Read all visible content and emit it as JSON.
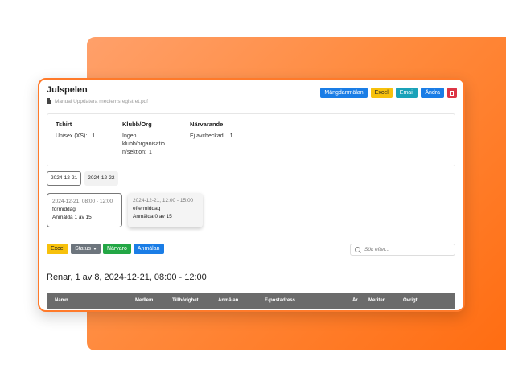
{
  "card": {
    "title": "Julspelen",
    "file_link": "Manual Uppdatera medlemsregistret.pdf",
    "buttons": {
      "mangdanmalan": "Mängdanmälan",
      "excel": "Excel",
      "email": "Email",
      "andra": "Ändra"
    }
  },
  "stats": {
    "tshirt": {
      "heading": "Tshirt",
      "label": "Unisex (XS):",
      "value": "1"
    },
    "klubb": {
      "heading": "Klubb/Org",
      "lines": [
        "Ingen",
        "klubb/organisatio",
        "n/sektion:"
      ],
      "value": "1"
    },
    "narvarande": {
      "heading": "Närvarande",
      "label": "Ej avcheckad:",
      "value": "1"
    }
  },
  "dates": [
    "2024-12-21",
    "2024-12-22"
  ],
  "slots": [
    {
      "time": "2024-12-21, 08:00 - 12:00",
      "part": "förmiddag",
      "count": "Anmälda 1 av 15"
    },
    {
      "time": "2024-12-21, 12:00 - 15:00",
      "part": "eftermiddag",
      "count": "Anmälda 0 av 15"
    }
  ],
  "actions": {
    "excel": "Excel",
    "status": "Status",
    "narvaro": "Närvaro",
    "anmalan": "Anmälan"
  },
  "search": {
    "placeholder": "Sök efter..."
  },
  "heading": "Renar, 1 av 8, 2024-12-21, 08:00 - 12:00",
  "table": {
    "columns": [
      "Namn",
      "Medlem",
      "Tillhörighet",
      "Anmälan",
      "E-postadress",
      "År",
      "Meriter",
      "Övrigt"
    ]
  },
  "colors": {
    "accent_orange": "#ff7a2a",
    "primary_blue": "#1a7de6",
    "warning_yellow": "#f7c10c",
    "info_teal": "#1aa2b8",
    "danger_red": "#dc3545",
    "success_green": "#23a745",
    "header_gray": "#6b6b6b"
  },
  "icons": {
    "file": "pdf-file-icon",
    "delete": "trash-icon",
    "search": "search-icon",
    "dropdown": "chevron-down-icon"
  }
}
